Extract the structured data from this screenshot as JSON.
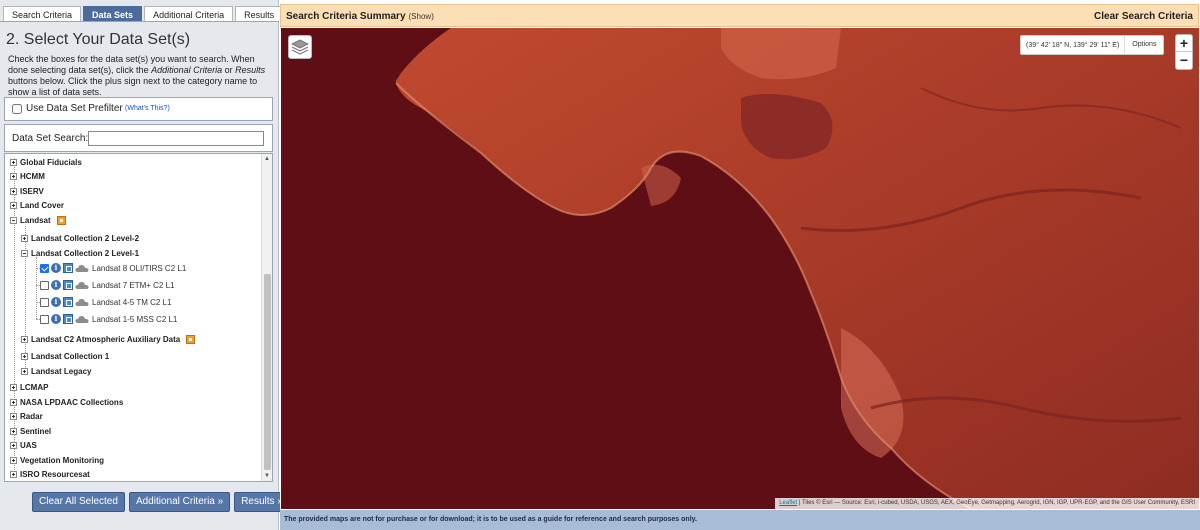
{
  "tabs": [
    "Search Criteria",
    "Data Sets",
    "Additional Criteria",
    "Results"
  ],
  "step_title": "2. Select Your Data Set(s)",
  "intro": {
    "p1": "Check the boxes for the data set(s) you want to search. When done selecting data set(s), click the ",
    "em1": "Additional Criteria",
    "p2": " or ",
    "em2": "Results",
    "p3": " buttons below. Click the plus sign next to the category name to show a list of data sets."
  },
  "prefilter": {
    "label": "Use Data Set Prefilter",
    "help": "(What's This?)"
  },
  "ds_search": {
    "label": "Data Set Search:",
    "value": ""
  },
  "tree": {
    "top": [
      "Global Fiducials",
      "HCMM",
      "ISERV",
      "Land Cover",
      "Landsat"
    ],
    "landsat_children": [
      "Landsat Collection 2 Level-2",
      "Landsat Collection 2 Level-1"
    ],
    "datasets": [
      {
        "label": "Landsat 8 OLI/TIRS C2 L1",
        "checked": true
      },
      {
        "label": "Landsat 7 ETM+ C2 L1",
        "checked": false
      },
      {
        "label": "Landsat 4-5 TM C2 L1",
        "checked": false
      },
      {
        "label": "Landsat 1-5 MSS C2 L1",
        "checked": false
      }
    ],
    "landsat_after": [
      "Landsat C2 Atmospheric Auxiliary Data",
      "Landsat Collection 1",
      "Landsat Legacy"
    ],
    "bottom": [
      "LCMAP",
      "NASA LPDAAC Collections",
      "Radar",
      "Sentinel",
      "UAS",
      "Vegetation Monitoring",
      "ISRO Resourcesat"
    ]
  },
  "buttons": [
    "Clear All Selected",
    "Additional Criteria »",
    "Results »"
  ],
  "summary": {
    "title": "Search Criteria Summary",
    "show": "(Show)",
    "clear": "Clear Search Criteria"
  },
  "map": {
    "coords": "(39° 42' 18\" N, 139° 29' 11\" E)",
    "options": "Options",
    "zoom_in": "+",
    "zoom_out": "−",
    "attribution_link": "Leaflet",
    "attribution_rest": " | Tiles © Esri — Source: Esri, i-cubed, USDA, USGS, AEX, GeoEye, Getmapping, Aerogrid, IGN, IGP, UPR-EGP, and the GIS User Community, ESRI"
  },
  "disclaimer": "The provided maps are not for purchase or for download; it is to be used as a guide for reference and search purposes only.",
  "colors": {
    "accent": "#5677a8",
    "tab_active": "#4c6a9c",
    "summary_bg": "#fcdfb5",
    "sea": "#5e0e14",
    "land": "#b2402c",
    "disclaimer_bg": "#a8bcd8"
  },
  "icons": [
    "layers-icon",
    "info-icon",
    "footprint-icon",
    "cloud-icon",
    "flag-icon",
    "expand-icon"
  ]
}
